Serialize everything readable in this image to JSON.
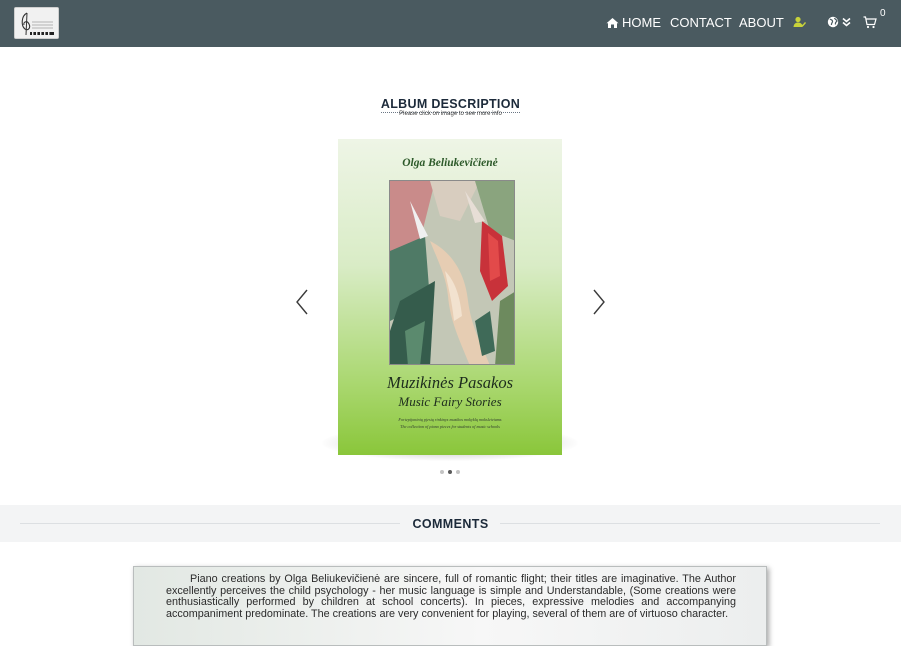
{
  "nav": {
    "home": "HOME",
    "contact": "CONTACT",
    "about": "ABOUT",
    "cart_count": "0"
  },
  "album": {
    "title": "ALBUM DESCRIPTION",
    "subtitle": "Please click on image to see more info",
    "cover": {
      "author": "Olga Beliukevičienė",
      "title_lt": "Muzikinės Pasakos",
      "title_en": "Music Fairy Stories",
      "desc_lt": "Fortepijoninių pjesių rinkinys muzikos mokyklų moksleiviams",
      "desc_en": "The collection of piano pieces for students of music schools"
    },
    "carousel": {
      "slide_count": 3,
      "active_index": 1
    }
  },
  "comments": {
    "heading": "COMMENTS",
    "items": [
      {
        "text": "Piano creations by Olga Beliukevičienė are sincere, full of romantic flight; their titles are imaginative. The Author excellently perceives the child psychology - her music language is simple and Understandable, (Some creations were enthusiastically performed by children at school concerts). In pieces, expressive melodies and accompanying accompaniment predominate. The creations are very convenient for playing, several of them are of virtuoso character."
      }
    ]
  },
  "colors": {
    "navbar": "#4a5a60",
    "user_icon": "#c8d33a",
    "cover_green": "#8ac63a",
    "heading": "#1c2a3a",
    "comments_band": "#f3f4f5"
  },
  "icons": {
    "home": "home-icon",
    "user": "user-check-icon",
    "language": "globe-icon",
    "language_toggle": "chevron-double-down-icon",
    "cart": "cart-icon",
    "prev": "chevron-left-icon",
    "next": "chevron-right-icon"
  }
}
